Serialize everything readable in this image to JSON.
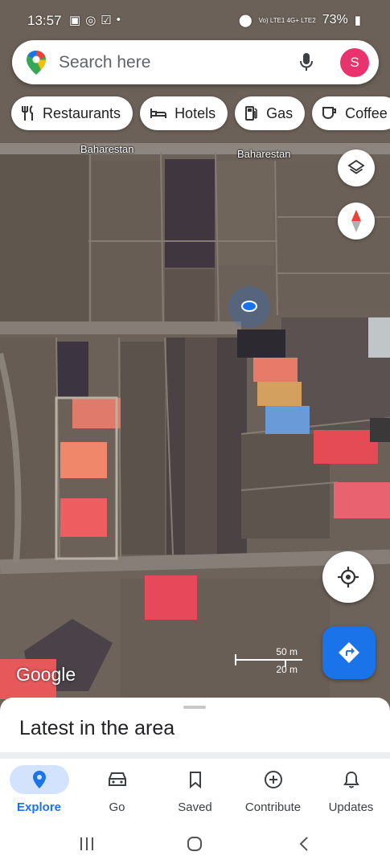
{
  "status_bar": {
    "time": "13:57",
    "network": "Vo) LTE1 4G+ LTE2",
    "battery": "73%"
  },
  "search": {
    "placeholder": "Search here",
    "avatar_letter": "S"
  },
  "chips": [
    {
      "label": "Restaurants",
      "icon": "fork-knife-icon"
    },
    {
      "label": "Hotels",
      "icon": "bed-icon"
    },
    {
      "label": "Gas",
      "icon": "gas-pump-icon"
    },
    {
      "label": "Coffee",
      "icon": "coffee-cup-icon"
    }
  ],
  "map": {
    "road_labels": [
      "Baharestan",
      "Baharestan"
    ],
    "attribution": "Google",
    "scale": {
      "top": "50 m",
      "bottom": "20 m"
    }
  },
  "sheet": {
    "title": "Latest in the area"
  },
  "bottom_nav": [
    {
      "label": "Explore",
      "icon": "location-pin-icon",
      "active": true
    },
    {
      "label": "Go",
      "icon": "car-icon",
      "active": false
    },
    {
      "label": "Saved",
      "icon": "bookmark-icon",
      "active": false
    },
    {
      "label": "Contribute",
      "icon": "add-circle-icon",
      "active": false
    },
    {
      "label": "Updates",
      "icon": "bell-icon",
      "active": false
    }
  ],
  "colors": {
    "accent": "#1a73e8",
    "avatar": "#e8336f",
    "active_tab_bg": "#d3e3fd"
  }
}
